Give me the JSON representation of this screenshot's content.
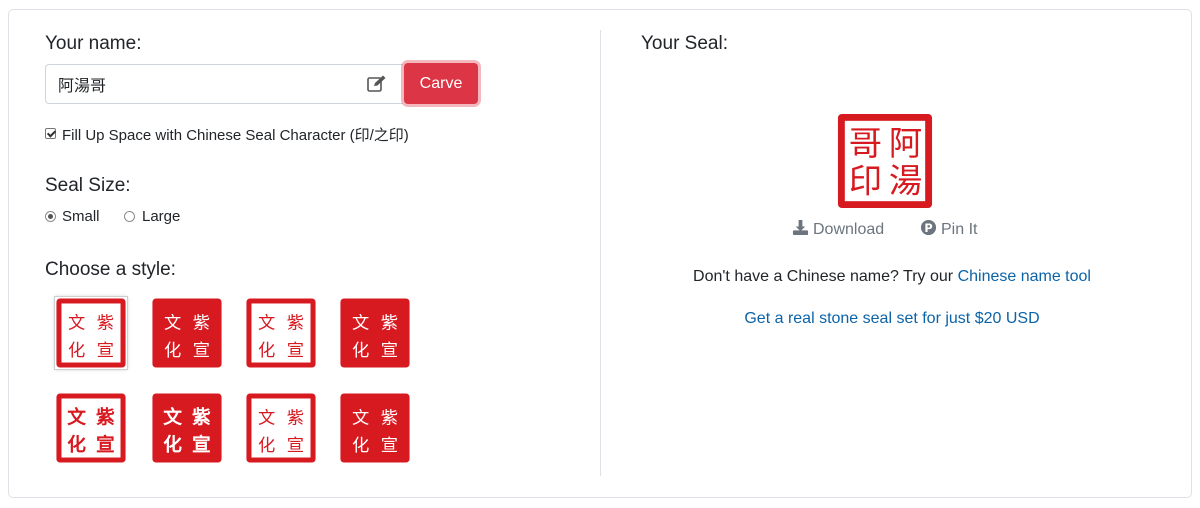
{
  "left": {
    "name_heading": "Your name:",
    "name_value": "阿湯哥",
    "carve_label": "Carve",
    "fill_checkbox_label": "Fill Up Space with Chinese Seal Character (印/之印)",
    "fill_checked": true,
    "size_heading": "Seal Size:",
    "size_options": [
      "Small",
      "Large"
    ],
    "size_selected": "Small",
    "style_heading": "Choose a style:",
    "styles": [
      {
        "chars": [
          "文",
          "紫",
          "化",
          "宣"
        ],
        "variant": "outline-seal",
        "selected": true
      },
      {
        "chars": [
          "文",
          "紫",
          "化",
          "宣"
        ],
        "variant": "solid-seal",
        "selected": false
      },
      {
        "chars": [
          "文",
          "紫",
          "化",
          "宣"
        ],
        "variant": "outline-regular",
        "selected": false
      },
      {
        "chars": [
          "文",
          "紫",
          "化",
          "宣"
        ],
        "variant": "solid-regular",
        "selected": false
      },
      {
        "chars": [
          "文",
          "紫",
          "化",
          "宣"
        ],
        "variant": "outline-regular-bold",
        "selected": false
      },
      {
        "chars": [
          "文",
          "紫",
          "化",
          "宣"
        ],
        "variant": "solid-regular-bold",
        "selected": false
      },
      {
        "chars": [
          "文",
          "紫",
          "化",
          "宣"
        ],
        "variant": "outline-ancient",
        "selected": false
      },
      {
        "chars": [
          "文",
          "紫",
          "化",
          "宣"
        ],
        "variant": "solid-ancient",
        "selected": false
      }
    ]
  },
  "right": {
    "seal_heading": "Your Seal:",
    "seal_chars": [
      "阿",
      "湯",
      "哥",
      "印"
    ],
    "download_label": "Download",
    "pin_label": "Pin It",
    "name_tool_prefix": "Don't have a Chinese name? Try our",
    "name_tool_link": "Chinese name tool",
    "stone_link": "Get a real stone seal set for just $20 USD"
  },
  "colors": {
    "seal_red": "#d71920",
    "carve_button": "#dc3545",
    "link": "#0b63a8",
    "muted": "#6c757d"
  },
  "icons": {
    "edit": "edit-icon",
    "download": "download-icon",
    "pin": "pinterest-icon"
  }
}
